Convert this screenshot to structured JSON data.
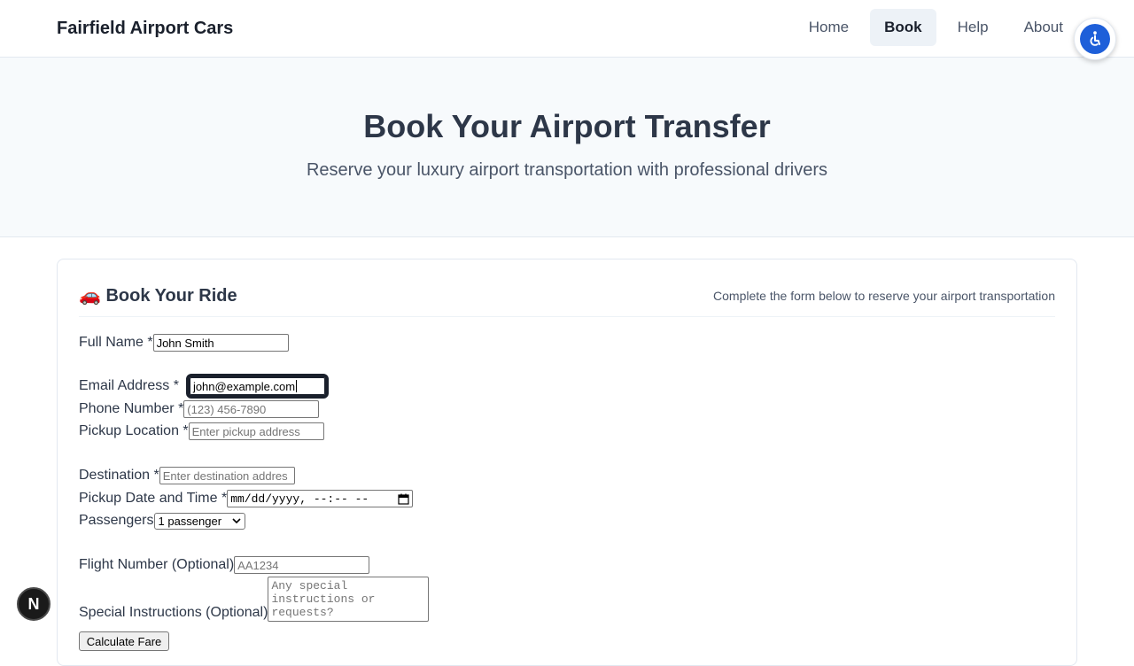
{
  "nav": {
    "brand": "Fairfield Airport Cars",
    "links": [
      {
        "label": "Home"
      },
      {
        "label": "Book"
      },
      {
        "label": "Help"
      },
      {
        "label": "About"
      }
    ]
  },
  "hero": {
    "title": "Book Your Airport Transfer",
    "subtitle": "Reserve your luxury airport transportation with professional drivers"
  },
  "card": {
    "title": "🚗 Book Your Ride",
    "subtitle": "Complete the form below to reserve your airport transportation"
  },
  "form": {
    "full_name": {
      "label": "Full Name *",
      "value": "John Smith"
    },
    "email": {
      "label": "Email Address *",
      "value": "john@example.com"
    },
    "phone": {
      "label": "Phone Number *",
      "placeholder": "(123) 456-7890"
    },
    "pickup": {
      "label": "Pickup Location *",
      "placeholder": "Enter pickup address"
    },
    "destination": {
      "label": "Destination *",
      "placeholder": "Enter destination addres"
    },
    "datetime": {
      "label": "Pickup Date and Time *",
      "placeholder": "mm/dd/yyyy, --:-- --"
    },
    "passengers": {
      "label": "Passengers",
      "selected": "1 passenger"
    },
    "flight": {
      "label": "Flight Number (Optional)",
      "placeholder": "AA1234"
    },
    "instructions": {
      "label": "Special Instructions (Optional)",
      "placeholder": "Any special instructions or requests?"
    },
    "calculate_label": "Calculate Fare"
  },
  "devtools": {
    "badge": "N"
  },
  "colors": {
    "accessibility_blue": "#1e5fd9",
    "text_dark": "#2d3748"
  }
}
